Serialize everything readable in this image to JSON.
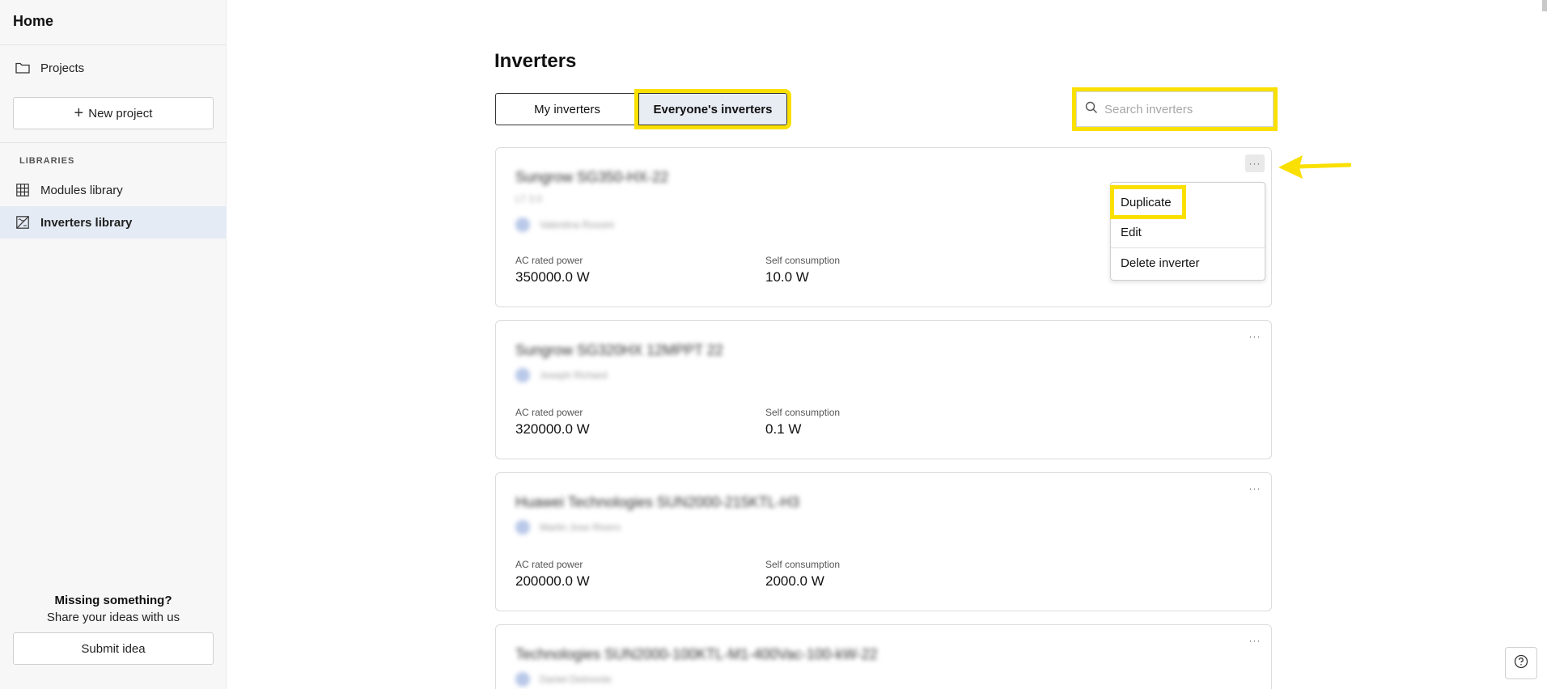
{
  "sidebar": {
    "home": "Home",
    "projects": "Projects",
    "new_project": "New project",
    "section_libraries": "LIBRARIES",
    "modules_library": "Modules library",
    "inverters_library": "Inverters library",
    "missing_title": "Missing something?",
    "missing_sub": "Share your ideas with us",
    "submit_idea": "Submit idea"
  },
  "main": {
    "title": "Inverters",
    "tabs": [
      {
        "label": "My inverters"
      },
      {
        "label": "Everyone's inverters"
      }
    ],
    "search_placeholder": "Search inverters",
    "cards": [
      {
        "title": "Sungrow SG350-HX-22",
        "sub": "LT 3.0",
        "owner": "Valentina Rossini",
        "ac_label": "AC rated power",
        "ac_value": "350000.0 W",
        "sc_label": "Self consumption",
        "sc_value": "10.0 W"
      },
      {
        "title": "Sungrow SG320HX 12MPPT 22",
        "owner": "Joseph Richard",
        "ac_label": "AC rated power",
        "ac_value": "320000.0 W",
        "sc_label": "Self consumption",
        "sc_value": "0.1 W"
      },
      {
        "title": "Huawei Technologies SUN2000-215KTL-H3",
        "owner": "Martin Jose Rivero",
        "ac_label": "AC rated power",
        "ac_value": "200000.0 W",
        "sc_label": "Self consumption",
        "sc_value": "2000.0 W"
      },
      {
        "title": "Technologies SUN2000-100KTL-M1-400Vac-100-kW-22",
        "owner": "Daniel Delmonte"
      }
    ],
    "context_menu": {
      "duplicate": "Duplicate",
      "edit": "Edit",
      "delete": "Delete inverter"
    },
    "dots": "···"
  },
  "colors": {
    "highlight": "#f9e000",
    "active_nav": "#e4ebf4"
  }
}
